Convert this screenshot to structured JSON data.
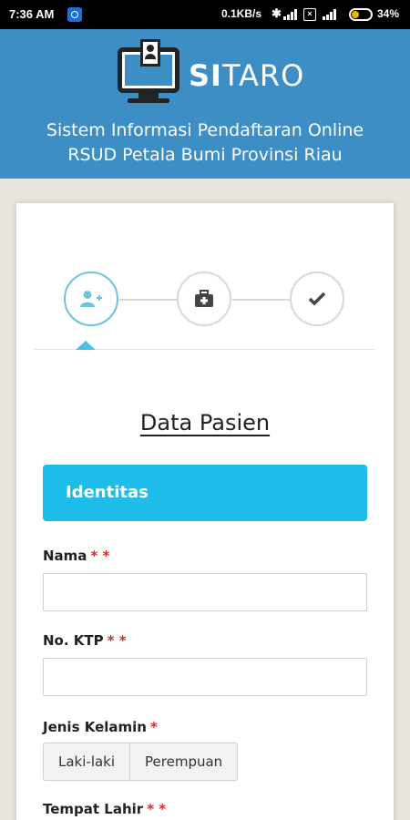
{
  "status_bar": {
    "time": "7:36 AM",
    "network_speed": "0.1KB/s",
    "battery_percent": "34%",
    "battery_level": 0.34
  },
  "header": {
    "brand_bold": "SI",
    "brand_rest": "TARO",
    "subtitle_line1": "Sistem Informasi Pendaftaran Online",
    "subtitle_line2": "RSUD Petala Bumi Provinsi Riau",
    "background_color": "#3d8ec5"
  },
  "steps": [
    {
      "icon": "add-user-icon",
      "active": true
    },
    {
      "icon": "medical-kit-icon",
      "active": false
    },
    {
      "icon": "checkmark-icon",
      "active": false
    }
  ],
  "form": {
    "section_title": "Data Pasien",
    "panel_title": "Identitas",
    "accent_color": "#1ebde9",
    "required_mark": "*",
    "fields": {
      "nama": {
        "label": "Nama",
        "required_marks": "* *",
        "value": ""
      },
      "ktp": {
        "label": "No. KTP",
        "required_marks": "* *",
        "value": ""
      },
      "jenis_kelamin": {
        "label": "Jenis Kelamin",
        "required_marks": "*",
        "options": [
          "Laki-laki",
          "Perempuan"
        ]
      },
      "tempat_lahir": {
        "label": "Tempat Lahir",
        "required_marks": "* *"
      }
    }
  }
}
